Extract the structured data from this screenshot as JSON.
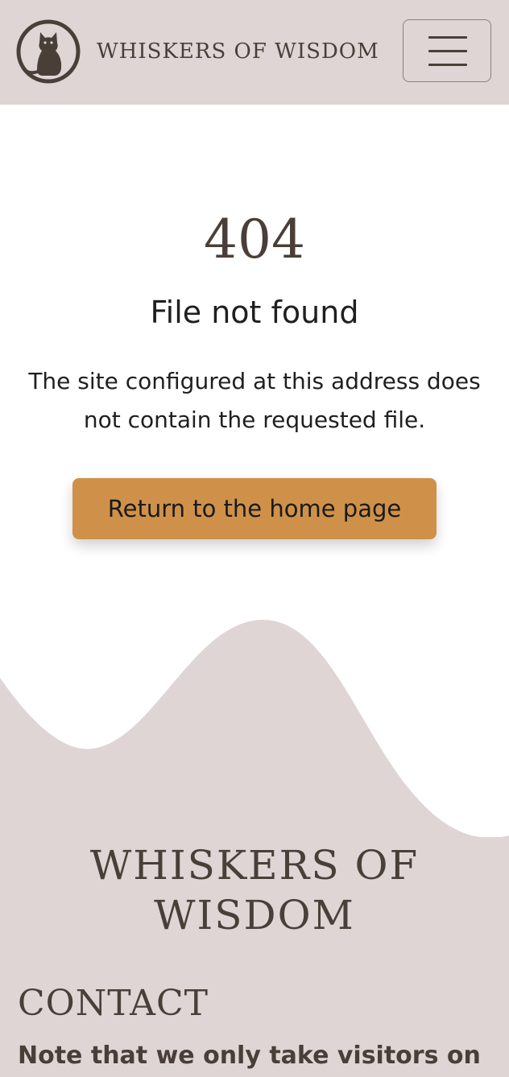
{
  "header": {
    "brand": "WHISKERS OF WISDOM",
    "logo_icon": "cat-silhouette-icon",
    "menu_icon": "hamburger-menu-icon"
  },
  "main": {
    "code": "404",
    "title": "File not found",
    "message": "The site configured at this address does not contain the requested file.",
    "home_button": "Return to the home page"
  },
  "footer": {
    "brand": "WHISKERS OF WISDOM",
    "contact_heading": "CONTACT",
    "contact_note": "Note that we only take visitors on"
  },
  "colors": {
    "header_bg": "#dfd5d5",
    "brand_text": "#4a3f38",
    "accent_button": "#cf9149",
    "page_bg": "#ffffff"
  }
}
